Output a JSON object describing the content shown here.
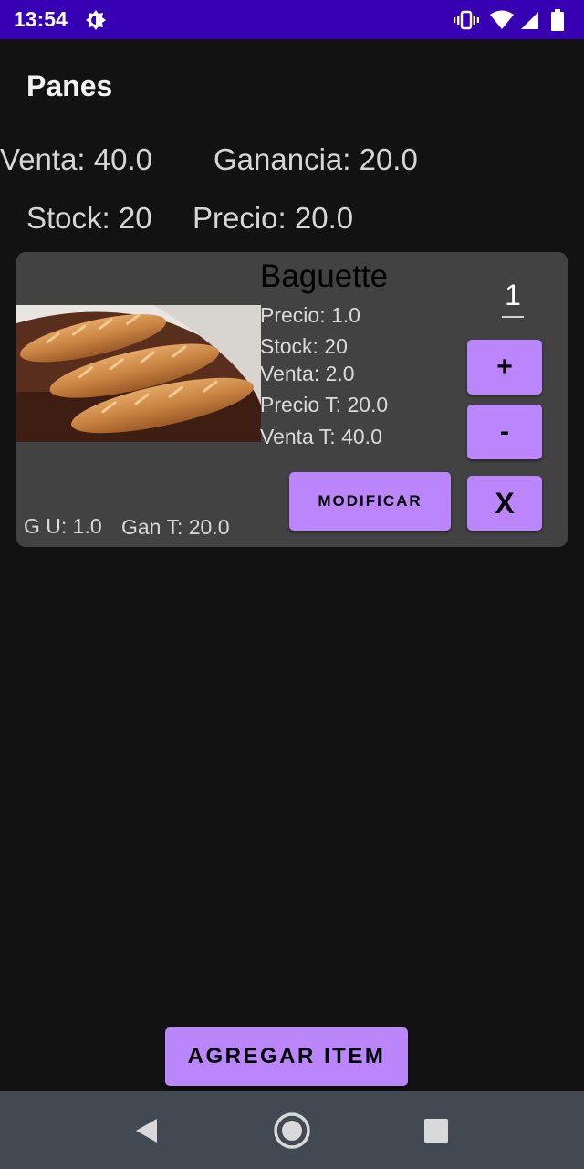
{
  "status_bar": {
    "time": "13:54",
    "icons": [
      "brightness-icon",
      "vibrate-icon",
      "wifi-icon",
      "signal-icon",
      "battery-icon"
    ],
    "color": "#3700b3"
  },
  "toolbar": {
    "title": "Panes"
  },
  "summary": {
    "venta": "Venta: 40.0",
    "ganancia": "Ganancia: 20.0",
    "stock": "Stock: 20",
    "precio": "Precio: 20.0"
  },
  "item": {
    "name": "Baguette",
    "quantity": "1",
    "details": {
      "precio": "Precio: 1.0",
      "stock": "Stock: 20",
      "venta": "Venta: 2.0",
      "precio_total": "Precio T: 20.0",
      "venta_total": "Venta T: 40.0"
    },
    "ganancia_unitaria": "G U: 1.0",
    "ganancia_total": "Gan T: 20.0",
    "buttons": {
      "plus": "+",
      "minus": "-",
      "delete": "X",
      "modify": "MODIFICAR"
    }
  },
  "add_button": "AGREGAR ITEM",
  "colors": {
    "accent": "#bb86fc",
    "background": "#121212",
    "card": "#424242",
    "nav_bar": "#414a52"
  },
  "nav_bar": {
    "icons": [
      "back-icon",
      "home-icon",
      "recents-icon"
    ]
  }
}
